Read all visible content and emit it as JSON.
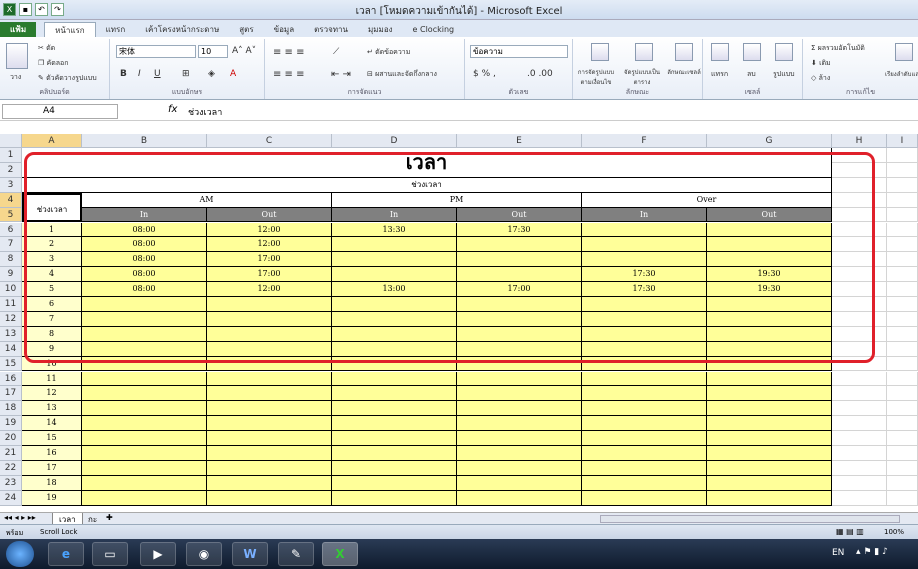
{
  "window": {
    "title": "เวลา  [โหมดความเข้ากันได้] - Microsoft Excel"
  },
  "tabs": [
    "แฟ้ม",
    "หน้าแรก",
    "แทรก",
    "เค้าโครงหน้ากระดาษ",
    "สูตร",
    "ข้อมูล",
    "ตรวจทาน",
    "มุมมอง",
    "e Clocking"
  ],
  "ribbon": {
    "clipboard": {
      "paste": "วาง",
      "cut": "ตัด",
      "copy": "คัดลอก",
      "format_painter": "ตัวคัดวางรูปแบบ",
      "label": "คลิปบอร์ด"
    },
    "font": {
      "name": "宋体",
      "size": "10",
      "bold": "B",
      "italic": "I",
      "underline": "U",
      "label": "แบบอักษร"
    },
    "alignment": {
      "wrap": "ตัดข้อความ",
      "merge": "ผสานและจัดกึ่งกลาง",
      "label": "การจัดแนว"
    },
    "number": {
      "format": "ข้อความ",
      "label": "ตัวเลข"
    },
    "styles": {
      "conditional": "การจัดรูปแบบตามเงื่อนไข",
      "table": "จัดรูปแบบเป็นตาราง",
      "cell_styles": "ลักษณะเซลล์",
      "label": "ลักษณะ"
    },
    "cells": {
      "insert": "แทรก",
      "delete": "ลบ",
      "format": "รูปแบบ",
      "label": "เซลล์"
    },
    "editing": {
      "autosum": "ผลรวมอัตโนมัติ",
      "fill": "เติม",
      "clear": "ล้าง",
      "sort": "เรียงลำดับและกรอง",
      "label": "การแก้ไข"
    }
  },
  "formula_bar": {
    "name_box": "A4",
    "fx": "fx",
    "value": "ช่วงเวลา"
  },
  "columns": [
    "A",
    "B",
    "C",
    "D",
    "E",
    "F",
    "G",
    "H",
    "I"
  ],
  "rows": [
    "1",
    "2",
    "3",
    "4",
    "5",
    "6",
    "7",
    "8",
    "9",
    "10",
    "11",
    "12",
    "13",
    "14",
    "15",
    "16",
    "17",
    "18",
    "19",
    "20",
    "21",
    "22",
    "23",
    "24"
  ],
  "sheet": {
    "title": "เวลา",
    "period_header": "ช่วงเวลา",
    "row_label": "ช่วงเวลา",
    "groups": [
      "AM",
      "PM",
      "Over"
    ],
    "sub": [
      "In",
      "Out",
      "In",
      "Out",
      "In",
      "Out"
    ],
    "data": [
      [
        "1",
        "08:00",
        "12:00",
        "13:30",
        "17:30",
        "",
        ""
      ],
      [
        "2",
        "08:00",
        "12:00",
        "",
        "",
        "",
        ""
      ],
      [
        "3",
        "08:00",
        "17:00",
        "",
        "",
        "",
        ""
      ],
      [
        "4",
        "08:00",
        "17:00",
        "",
        "",
        "17:30",
        "19:30"
      ],
      [
        "5",
        "08:00",
        "12:00",
        "13:00",
        "17:00",
        "17:30",
        "19:30"
      ],
      [
        "6",
        "",
        "",
        "",
        "",
        "",
        ""
      ],
      [
        "7",
        "",
        "",
        "",
        "",
        "",
        ""
      ],
      [
        "8",
        "",
        "",
        "",
        "",
        "",
        ""
      ],
      [
        "9",
        "",
        "",
        "",
        "",
        "",
        ""
      ],
      [
        "10",
        "",
        "",
        "",
        "",
        "",
        ""
      ],
      [
        "11",
        "",
        "",
        "",
        "",
        "",
        ""
      ],
      [
        "12",
        "",
        "",
        "",
        "",
        "",
        ""
      ],
      [
        "13",
        "",
        "",
        "",
        "",
        "",
        ""
      ],
      [
        "14",
        "",
        "",
        "",
        "",
        "",
        ""
      ],
      [
        "15",
        "",
        "",
        "",
        "",
        "",
        ""
      ],
      [
        "16",
        "",
        "",
        "",
        "",
        "",
        ""
      ],
      [
        "17",
        "",
        "",
        "",
        "",
        "",
        ""
      ],
      [
        "18",
        "",
        "",
        "",
        "",
        "",
        ""
      ],
      [
        "19",
        "",
        "",
        "",
        "",
        "",
        ""
      ]
    ]
  },
  "sheet_tabs": [
    "เวลา",
    "กะ"
  ],
  "status": {
    "ready": "พร้อม",
    "scroll_lock": "Scroll Lock",
    "zoom": "100%"
  },
  "taskbar": {
    "lang": "EN"
  }
}
